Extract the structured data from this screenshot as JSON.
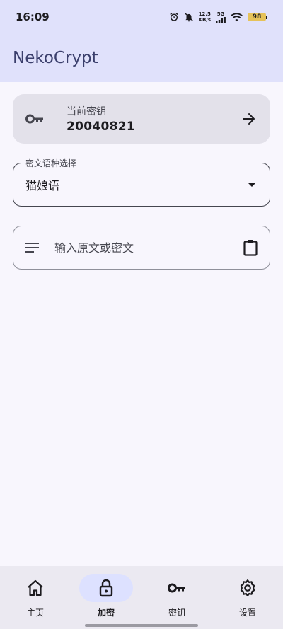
{
  "status_bar": {
    "time": "16:09",
    "net_speed_value": "12.5",
    "net_speed_unit": "KB/s",
    "network_type": "5G",
    "battery": "98"
  },
  "app_bar": {
    "title": "NekoCrypt"
  },
  "key_card": {
    "label": "当前密钥",
    "value": "20040821",
    "icon": "key-icon",
    "action_icon": "arrow-right-icon"
  },
  "cipher_select": {
    "legend": "密文语种选择",
    "value": "猫娘语"
  },
  "text_input": {
    "placeholder": "输入原文或密文",
    "value": ""
  },
  "bottom_nav": {
    "items": [
      {
        "label": "主页",
        "icon": "home-icon"
      },
      {
        "label": "加密",
        "icon": "lock-icon",
        "active": true
      },
      {
        "label": "密钥",
        "icon": "key-icon"
      },
      {
        "label": "设置",
        "icon": "gear-icon"
      }
    ]
  },
  "colors": {
    "header_bg": "#e0e1fb",
    "page_bg": "#f8f6fd",
    "card_bg": "#e3e1ea",
    "nav_bg": "#ebe9f1",
    "active_pill": "#dde1ff",
    "title_color": "#3b3f6c"
  }
}
